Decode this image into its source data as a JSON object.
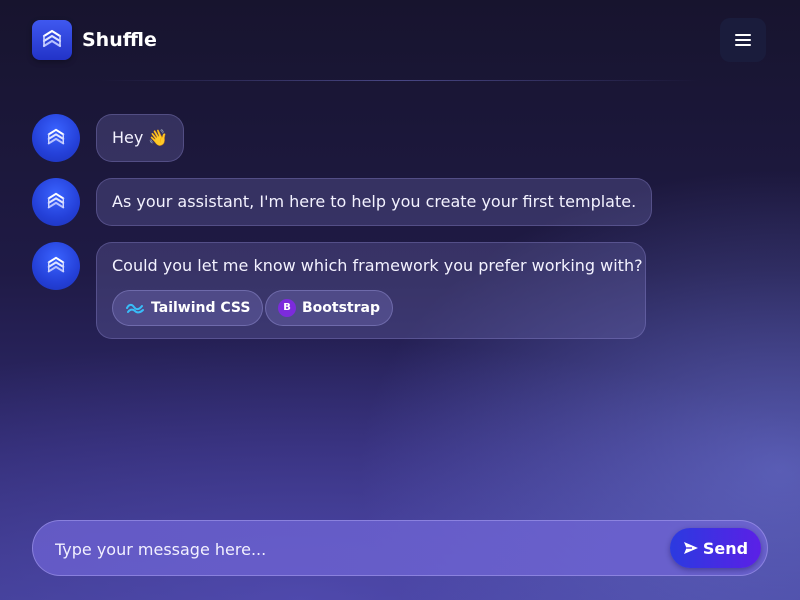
{
  "app": {
    "name": "Shuffle",
    "logo_icon": "shuffle-logo-icon",
    "menu_icon": "hamburger-menu-icon"
  },
  "messages": [
    {
      "sender": "assistant",
      "text": "Hey 👋"
    },
    {
      "sender": "assistant",
      "text": "As your assistant, I'm here to help you create your first template."
    },
    {
      "sender": "assistant",
      "text": "Could you let me know which framework you prefer working with?",
      "options": [
        {
          "label": "Tailwind CSS",
          "icon": "tailwind-logo-icon"
        },
        {
          "label": "Bootstrap",
          "icon": "bootstrap-logo-icon",
          "badge": "B"
        }
      ]
    }
  ],
  "composer": {
    "placeholder": "Type your message here...",
    "value": "",
    "send_label": "Send",
    "send_icon": "paper-plane-icon"
  },
  "colors": {
    "accent": "#2b3ae0",
    "accent_end": "#5b20e6",
    "avatar": "#2440d8",
    "bootstrap": "#7c2bdc",
    "tailwind": "#38bdf8"
  }
}
